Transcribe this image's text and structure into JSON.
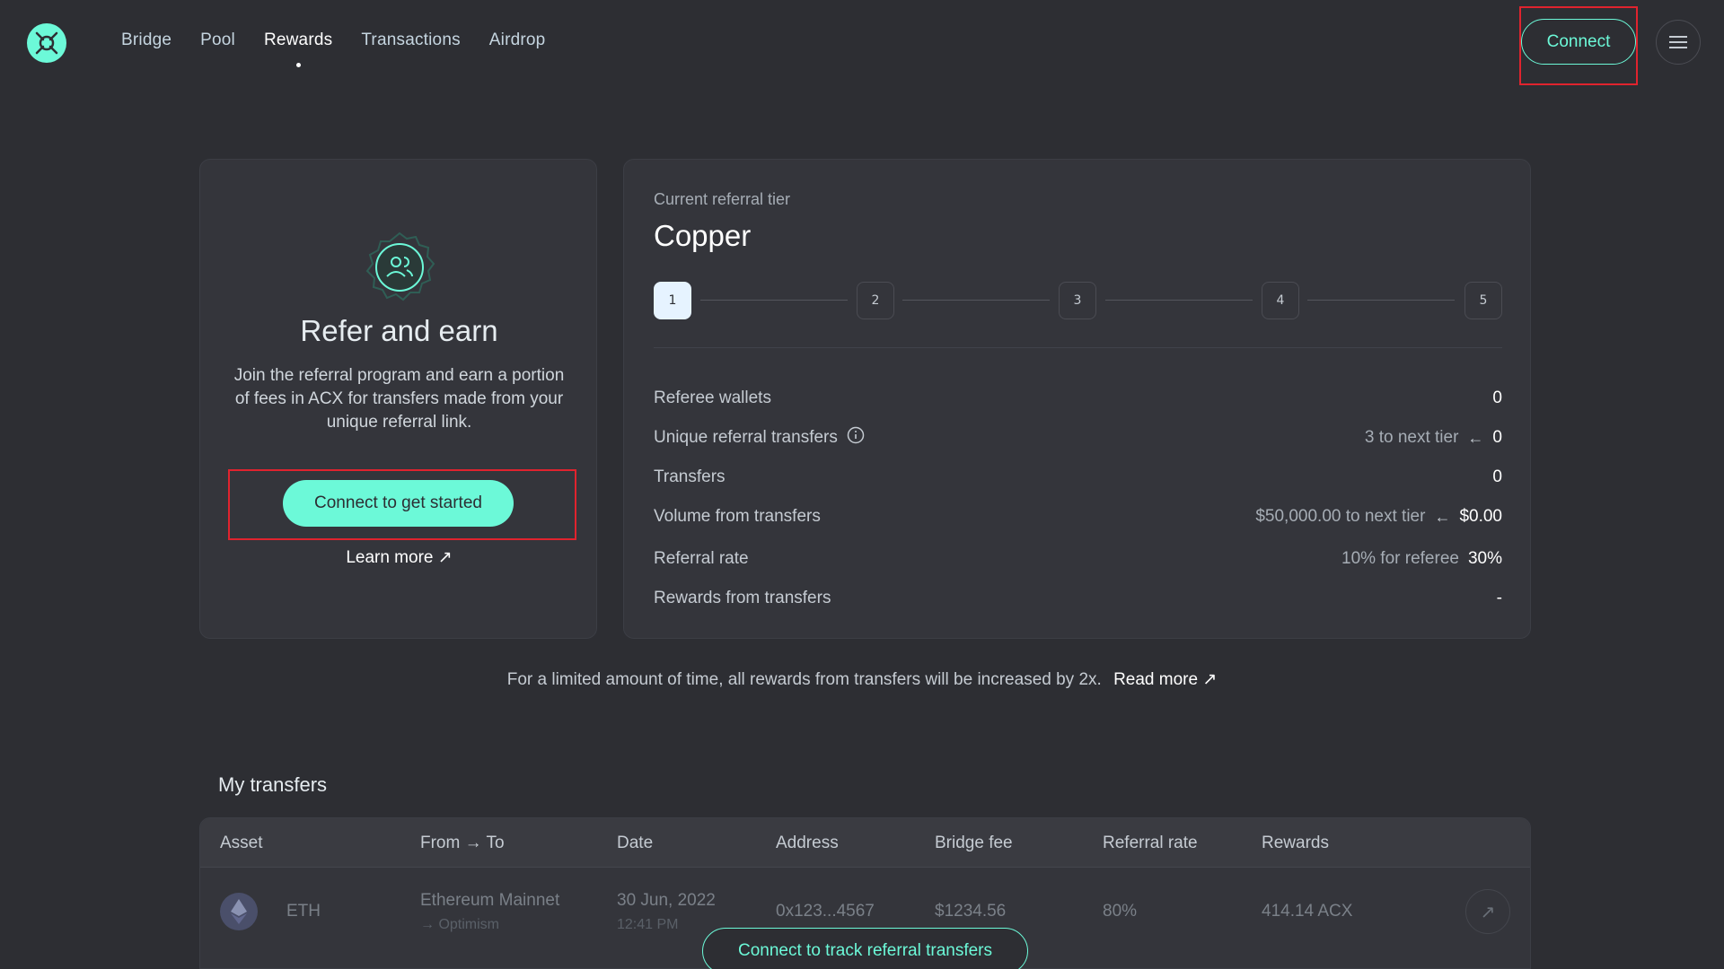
{
  "nav": {
    "items": [
      {
        "label": "Bridge",
        "active": false
      },
      {
        "label": "Pool",
        "active": false
      },
      {
        "label": "Rewards",
        "active": true
      },
      {
        "label": "Transactions",
        "active": false
      },
      {
        "label": "Airdrop",
        "active": false
      }
    ],
    "connect_label": "Connect",
    "menu_icon": "hamburger-menu-icon",
    "logo_icon": "across-logo-icon"
  },
  "refer": {
    "title": "Refer and earn",
    "description": "Join the referral program and earn a portion of fees in ACX for transfers made from your unique referral link.",
    "cta_label": "Connect to get started",
    "learn_more_label": "Learn more ↗",
    "badge_icon": "users-badge-icon"
  },
  "tier": {
    "label": "Current referral tier",
    "name": "Copper",
    "steps": [
      "1",
      "2",
      "3",
      "4",
      "5"
    ],
    "current_step": 1
  },
  "stats": {
    "referee_wallets": {
      "label": "Referee wallets",
      "value": "0"
    },
    "unique_transfers": {
      "label": "Unique referral transfers",
      "note": "3 to next tier",
      "value": "0"
    },
    "transfers": {
      "label": "Transfers",
      "value": "0"
    },
    "volume": {
      "label": "Volume from transfers",
      "note": "$50,000.00 to next tier",
      "value": "$0.00"
    },
    "referral_rate": {
      "label": "Referral rate",
      "note": "10% for referee",
      "value": "30%"
    },
    "rewards": {
      "label": "Rewards from transfers",
      "value": "-"
    }
  },
  "promo": {
    "text": "For a limited amount of time, all rewards from transfers will be increased by 2x.",
    "link": "Read more ↗"
  },
  "transfers": {
    "title": "My transfers",
    "columns": [
      "Asset",
      "From → To",
      "Date",
      "Address",
      "Bridge fee",
      "Referral rate",
      "Rewards"
    ],
    "row": {
      "asset": "ETH",
      "from": "Ethereum Mainnet",
      "to": "→ Optimism",
      "date": "30 Jun, 2022",
      "time": "12:41 PM",
      "address": "0x123...4567",
      "bridge_fee": "$1234.56",
      "referral_rate": "80%",
      "rewards": "414.14 ACX"
    },
    "overlay_cta": "Connect to track referral transfers"
  },
  "colors": {
    "accent": "#6cf9d8",
    "background": "#2d2e33",
    "card": "#34353b",
    "highlight": "#e0232e"
  }
}
